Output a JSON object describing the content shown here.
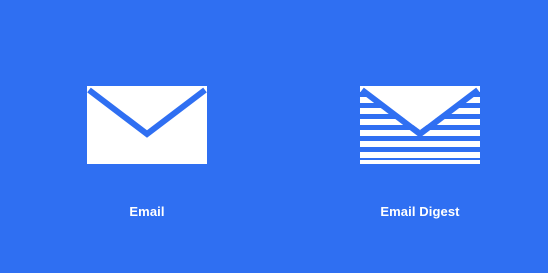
{
  "background_color": "#2f6ff2",
  "options": [
    {
      "label": "Email",
      "icon": "envelope-icon"
    },
    {
      "label": "Email Digest",
      "icon": "envelope-lines-icon"
    }
  ]
}
